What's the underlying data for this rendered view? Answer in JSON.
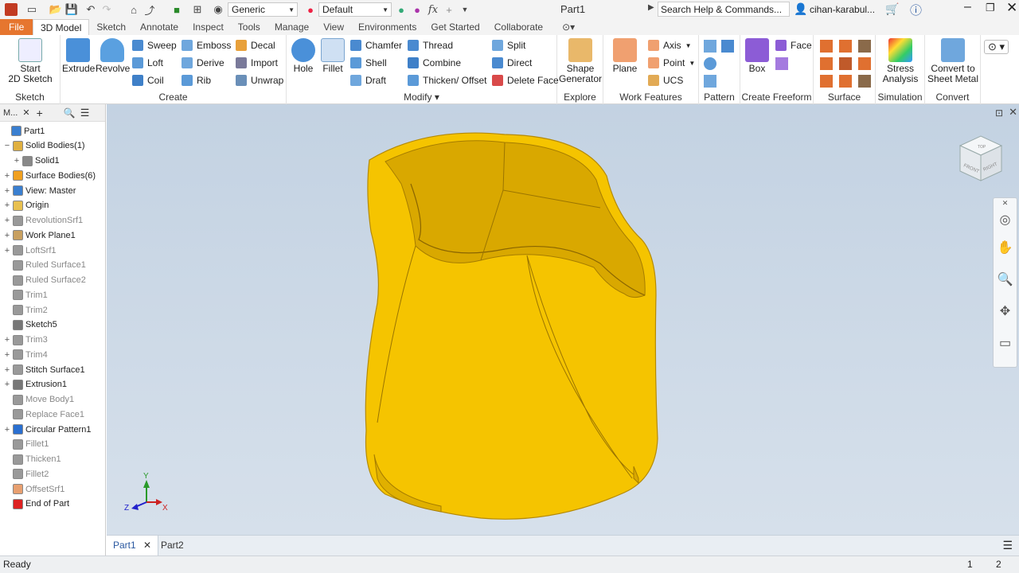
{
  "window": {
    "title": "Part1"
  },
  "qat": {
    "appearance": "Generic",
    "design_view": "Default"
  },
  "search": {
    "placeholder": "Search Help & Commands..."
  },
  "account": {
    "user": "cihan-karabul..."
  },
  "menu": {
    "file": "File",
    "tabs": [
      "3D Model",
      "Sketch",
      "Annotate",
      "Inspect",
      "Tools",
      "Manage",
      "View",
      "Environments",
      "Get Started",
      "Collaborate"
    ]
  },
  "ribbon": {
    "sketch": {
      "start": "Start",
      "start2": "2D Sketch",
      "label": "Sketch"
    },
    "create": {
      "extrude": "Extrude",
      "revolve": "Revolve",
      "sweep": "Sweep",
      "emboss": "Emboss",
      "decal": "Decal",
      "loft": "Loft",
      "derive": "Derive",
      "import": "Import",
      "coil": "Coil",
      "rib": "Rib",
      "unwrap": "Unwrap",
      "label": "Create"
    },
    "modify": {
      "hole": "Hole",
      "fillet": "Fillet",
      "chamfer": "Chamfer",
      "thread": "Thread",
      "split": "Split",
      "shell": "Shell",
      "combine": "Combine",
      "direct": "Direct",
      "draft": "Draft",
      "thicken": "Thicken/ Offset",
      "delete_face": "Delete Face",
      "label": "Modify"
    },
    "explore": {
      "shape1": "Shape",
      "shape2": "Generator",
      "label": "Explore"
    },
    "work": {
      "plane": "Plane",
      "axis": "Axis",
      "point": "Point",
      "ucs": "UCS",
      "label": "Work Features"
    },
    "pattern": {
      "label": "Pattern"
    },
    "freeform": {
      "box": "Box",
      "face": "Face",
      "label": "Create Freeform"
    },
    "surface": {
      "label": "Surface"
    },
    "simulation": {
      "stress1": "Stress",
      "stress2": "Analysis",
      "label": "Simulation"
    },
    "convert": {
      "c1": "Convert to",
      "c2": "Sheet Metal",
      "label": "Convert"
    }
  },
  "browser": {
    "title": "M...",
    "items": [
      {
        "label": "Part1",
        "dim": false
      },
      {
        "label": "Solid Bodies(1)",
        "dim": false
      },
      {
        "label": "Solid1",
        "dim": false
      },
      {
        "label": "Surface Bodies(6)",
        "dim": false
      },
      {
        "label": "View: Master",
        "dim": false
      },
      {
        "label": "Origin",
        "dim": false
      },
      {
        "label": "RevolutionSrf1",
        "dim": true
      },
      {
        "label": "Work Plane1",
        "dim": false
      },
      {
        "label": "LoftSrf1",
        "dim": true
      },
      {
        "label": "Ruled Surface1",
        "dim": true
      },
      {
        "label": "Ruled Surface2",
        "dim": true
      },
      {
        "label": "Trim1",
        "dim": true
      },
      {
        "label": "Trim2",
        "dim": true
      },
      {
        "label": "Sketch5",
        "dim": false
      },
      {
        "label": "Trim3",
        "dim": true
      },
      {
        "label": "Trim4",
        "dim": true
      },
      {
        "label": "Stitch Surface1",
        "dim": false
      },
      {
        "label": "Extrusion1",
        "dim": false
      },
      {
        "label": "Move Body1",
        "dim": true
      },
      {
        "label": "Replace Face1",
        "dim": true
      },
      {
        "label": "Circular Pattern1",
        "dim": false
      },
      {
        "label": "Fillet1",
        "dim": true
      },
      {
        "label": "Thicken1",
        "dim": true
      },
      {
        "label": "Fillet2",
        "dim": true
      },
      {
        "label": "OffsetSrf1",
        "dim": true
      },
      {
        "label": "End of Part",
        "dim": false
      }
    ]
  },
  "viewcube": {
    "front": "FRONT",
    "right": "RIGHT",
    "top": "TOP"
  },
  "triad": {
    "x": "X",
    "y": "Y",
    "z": "Z"
  },
  "doc_tabs": [
    "Part1",
    "Part2"
  ],
  "status": {
    "text": "Ready",
    "n1": "1",
    "n2": "2"
  },
  "colors": {
    "model": "#f5c400",
    "file_tab": "#e6762f",
    "viewport_bg": "#c9d6e4"
  }
}
